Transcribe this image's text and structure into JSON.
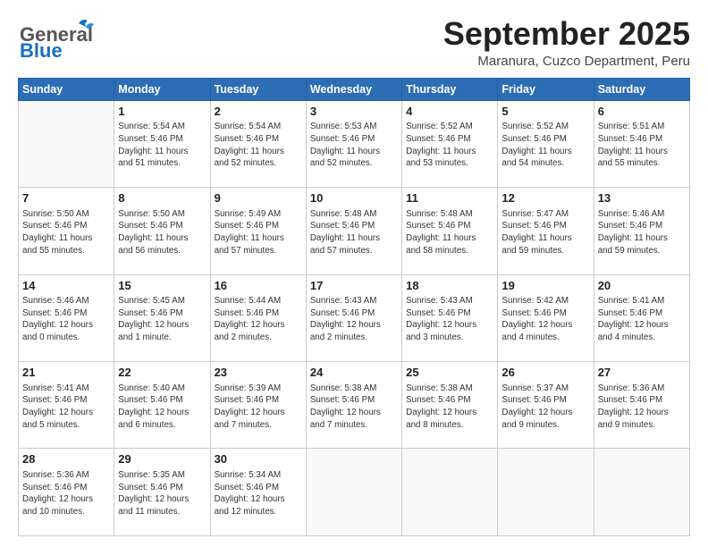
{
  "header": {
    "logo_general": "General",
    "logo_blue": "Blue",
    "month": "September 2025",
    "location": "Maranura, Cuzco Department, Peru"
  },
  "weekdays": [
    "Sunday",
    "Monday",
    "Tuesday",
    "Wednesday",
    "Thursday",
    "Friday",
    "Saturday"
  ],
  "weeks": [
    [
      {
        "day": "",
        "info": ""
      },
      {
        "day": "1",
        "info": "Sunrise: 5:54 AM\nSunset: 5:46 PM\nDaylight: 11 hours\nand 51 minutes."
      },
      {
        "day": "2",
        "info": "Sunrise: 5:54 AM\nSunset: 5:46 PM\nDaylight: 11 hours\nand 52 minutes."
      },
      {
        "day": "3",
        "info": "Sunrise: 5:53 AM\nSunset: 5:46 PM\nDaylight: 11 hours\nand 52 minutes."
      },
      {
        "day": "4",
        "info": "Sunrise: 5:52 AM\nSunset: 5:46 PM\nDaylight: 11 hours\nand 53 minutes."
      },
      {
        "day": "5",
        "info": "Sunrise: 5:52 AM\nSunset: 5:46 PM\nDaylight: 11 hours\nand 54 minutes."
      },
      {
        "day": "6",
        "info": "Sunrise: 5:51 AM\nSunset: 5:46 PM\nDaylight: 11 hours\nand 55 minutes."
      }
    ],
    [
      {
        "day": "7",
        "info": "Sunrise: 5:50 AM\nSunset: 5:46 PM\nDaylight: 11 hours\nand 55 minutes."
      },
      {
        "day": "8",
        "info": "Sunrise: 5:50 AM\nSunset: 5:46 PM\nDaylight: 11 hours\nand 56 minutes."
      },
      {
        "day": "9",
        "info": "Sunrise: 5:49 AM\nSunset: 5:46 PM\nDaylight: 11 hours\nand 57 minutes."
      },
      {
        "day": "10",
        "info": "Sunrise: 5:48 AM\nSunset: 5:46 PM\nDaylight: 11 hours\nand 57 minutes."
      },
      {
        "day": "11",
        "info": "Sunrise: 5:48 AM\nSunset: 5:46 PM\nDaylight: 11 hours\nand 58 minutes."
      },
      {
        "day": "12",
        "info": "Sunrise: 5:47 AM\nSunset: 5:46 PM\nDaylight: 11 hours\nand 59 minutes."
      },
      {
        "day": "13",
        "info": "Sunrise: 5:46 AM\nSunset: 5:46 PM\nDaylight: 11 hours\nand 59 minutes."
      }
    ],
    [
      {
        "day": "14",
        "info": "Sunrise: 5:46 AM\nSunset: 5:46 PM\nDaylight: 12 hours\nand 0 minutes."
      },
      {
        "day": "15",
        "info": "Sunrise: 5:45 AM\nSunset: 5:46 PM\nDaylight: 12 hours\nand 1 minute."
      },
      {
        "day": "16",
        "info": "Sunrise: 5:44 AM\nSunset: 5:46 PM\nDaylight: 12 hours\nand 2 minutes."
      },
      {
        "day": "17",
        "info": "Sunrise: 5:43 AM\nSunset: 5:46 PM\nDaylight: 12 hours\nand 2 minutes."
      },
      {
        "day": "18",
        "info": "Sunrise: 5:43 AM\nSunset: 5:46 PM\nDaylight: 12 hours\nand 3 minutes."
      },
      {
        "day": "19",
        "info": "Sunrise: 5:42 AM\nSunset: 5:46 PM\nDaylight: 12 hours\nand 4 minutes."
      },
      {
        "day": "20",
        "info": "Sunrise: 5:41 AM\nSunset: 5:46 PM\nDaylight: 12 hours\nand 4 minutes."
      }
    ],
    [
      {
        "day": "21",
        "info": "Sunrise: 5:41 AM\nSunset: 5:46 PM\nDaylight: 12 hours\nand 5 minutes."
      },
      {
        "day": "22",
        "info": "Sunrise: 5:40 AM\nSunset: 5:46 PM\nDaylight: 12 hours\nand 6 minutes."
      },
      {
        "day": "23",
        "info": "Sunrise: 5:39 AM\nSunset: 5:46 PM\nDaylight: 12 hours\nand 7 minutes."
      },
      {
        "day": "24",
        "info": "Sunrise: 5:38 AM\nSunset: 5:46 PM\nDaylight: 12 hours\nand 7 minutes."
      },
      {
        "day": "25",
        "info": "Sunrise: 5:38 AM\nSunset: 5:46 PM\nDaylight: 12 hours\nand 8 minutes."
      },
      {
        "day": "26",
        "info": "Sunrise: 5:37 AM\nSunset: 5:46 PM\nDaylight: 12 hours\nand 9 minutes."
      },
      {
        "day": "27",
        "info": "Sunrise: 5:36 AM\nSunset: 5:46 PM\nDaylight: 12 hours\nand 9 minutes."
      }
    ],
    [
      {
        "day": "28",
        "info": "Sunrise: 5:36 AM\nSunset: 5:46 PM\nDaylight: 12 hours\nand 10 minutes."
      },
      {
        "day": "29",
        "info": "Sunrise: 5:35 AM\nSunset: 5:46 PM\nDaylight: 12 hours\nand 11 minutes."
      },
      {
        "day": "30",
        "info": "Sunrise: 5:34 AM\nSunset: 5:46 PM\nDaylight: 12 hours\nand 12 minutes."
      },
      {
        "day": "",
        "info": ""
      },
      {
        "day": "",
        "info": ""
      },
      {
        "day": "",
        "info": ""
      },
      {
        "day": "",
        "info": ""
      }
    ]
  ]
}
